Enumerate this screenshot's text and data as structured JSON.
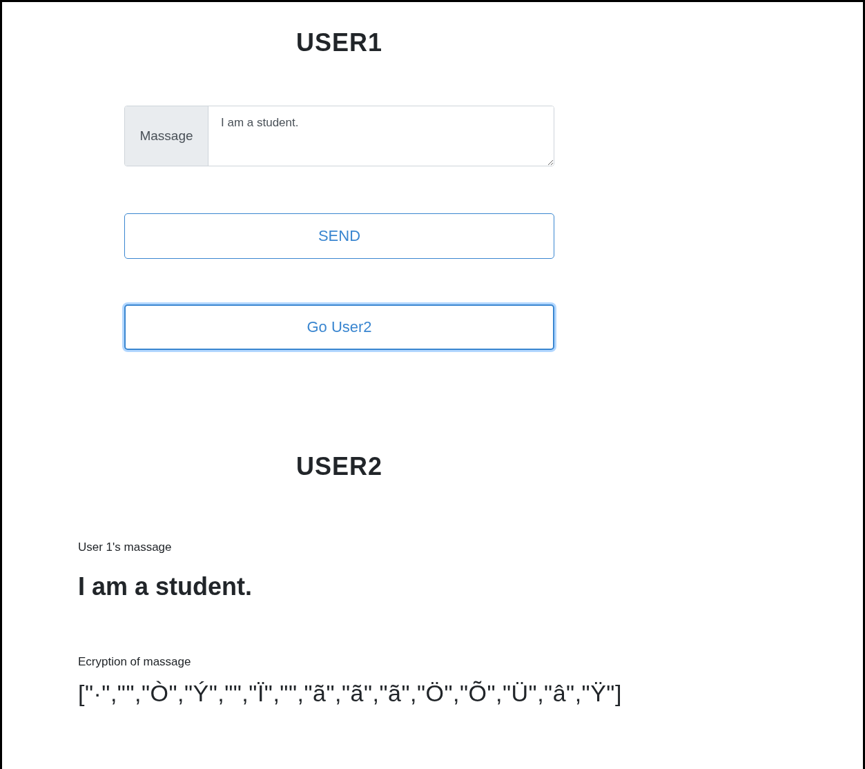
{
  "user1": {
    "title": "USER1",
    "message_field": {
      "label": "Massage",
      "value": "I am a student."
    },
    "buttons": [
      {
        "label": "SEND",
        "focused": false
      },
      {
        "label": "Go User2",
        "focused": true
      }
    ]
  },
  "user2": {
    "title": "USER2",
    "message_caption": "User 1's massage",
    "message": "I am a student.",
    "encryption_caption": "Ecryption of massage",
    "encryption": "[\"·\",\"\",\"Ò\",\"Ý\",\"\",\"Ï\",\"\",\"ã\",\"ã\",\"ã\",\"Ö\",\"Õ\",\"Ü\",\"â\",\"Ÿ\"]"
  }
}
